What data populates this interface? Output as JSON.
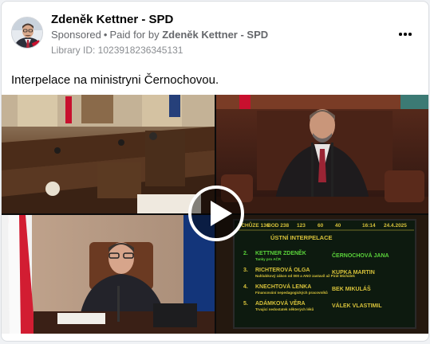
{
  "post": {
    "page_name": "Zdeněk Kettner - SPD",
    "sponsored_label": "Sponsored",
    "paid_prefix": "Paid for by",
    "paid_by": "Zdeněk Kettner - SPD",
    "library_id": "Library ID: 1023918236345131",
    "text": "Interpelace na ministryni Černochovou."
  },
  "board": {
    "status_items": [
      "SCHŮZE 136",
      "BOD 238",
      "123",
      "60",
      "40",
      "16:14",
      "24.4.2025"
    ],
    "title": "ÚSTNÍ INTERPELACE",
    "rows": [
      {
        "num": "2.",
        "asker": "KETTNER ZDENĚK",
        "subject": "Tanky pro AČR",
        "minister": "ČERNOCHOVÁ JANA",
        "active": true
      },
      {
        "num": "3.",
        "asker": "RICHTEROVÁ OLGA",
        "subject": "Nahlubkový zákon od 000 a ANO zastavil až Pirát Michálek",
        "minister": "KUPKA MARTIN",
        "active": false
      },
      {
        "num": "4.",
        "asker": "KNECHTOVÁ LENKA",
        "subject": "Financování nepedagogických pracovníků",
        "minister": "BEK MIKULÁŠ",
        "active": false
      },
      {
        "num": "5.",
        "asker": "ADÁMKOVÁ VĚRA",
        "subject": "Trvající nedostatek některých léků",
        "minister": "VÁLEK VLASTIMIL",
        "active": false
      }
    ]
  },
  "icons": {
    "more": "more-horizontal-icon",
    "play": "play-icon"
  },
  "colors": {
    "board_text": "#d6c13a",
    "board_bg": "#0d1a0f",
    "active_row": "#5ad23a"
  }
}
